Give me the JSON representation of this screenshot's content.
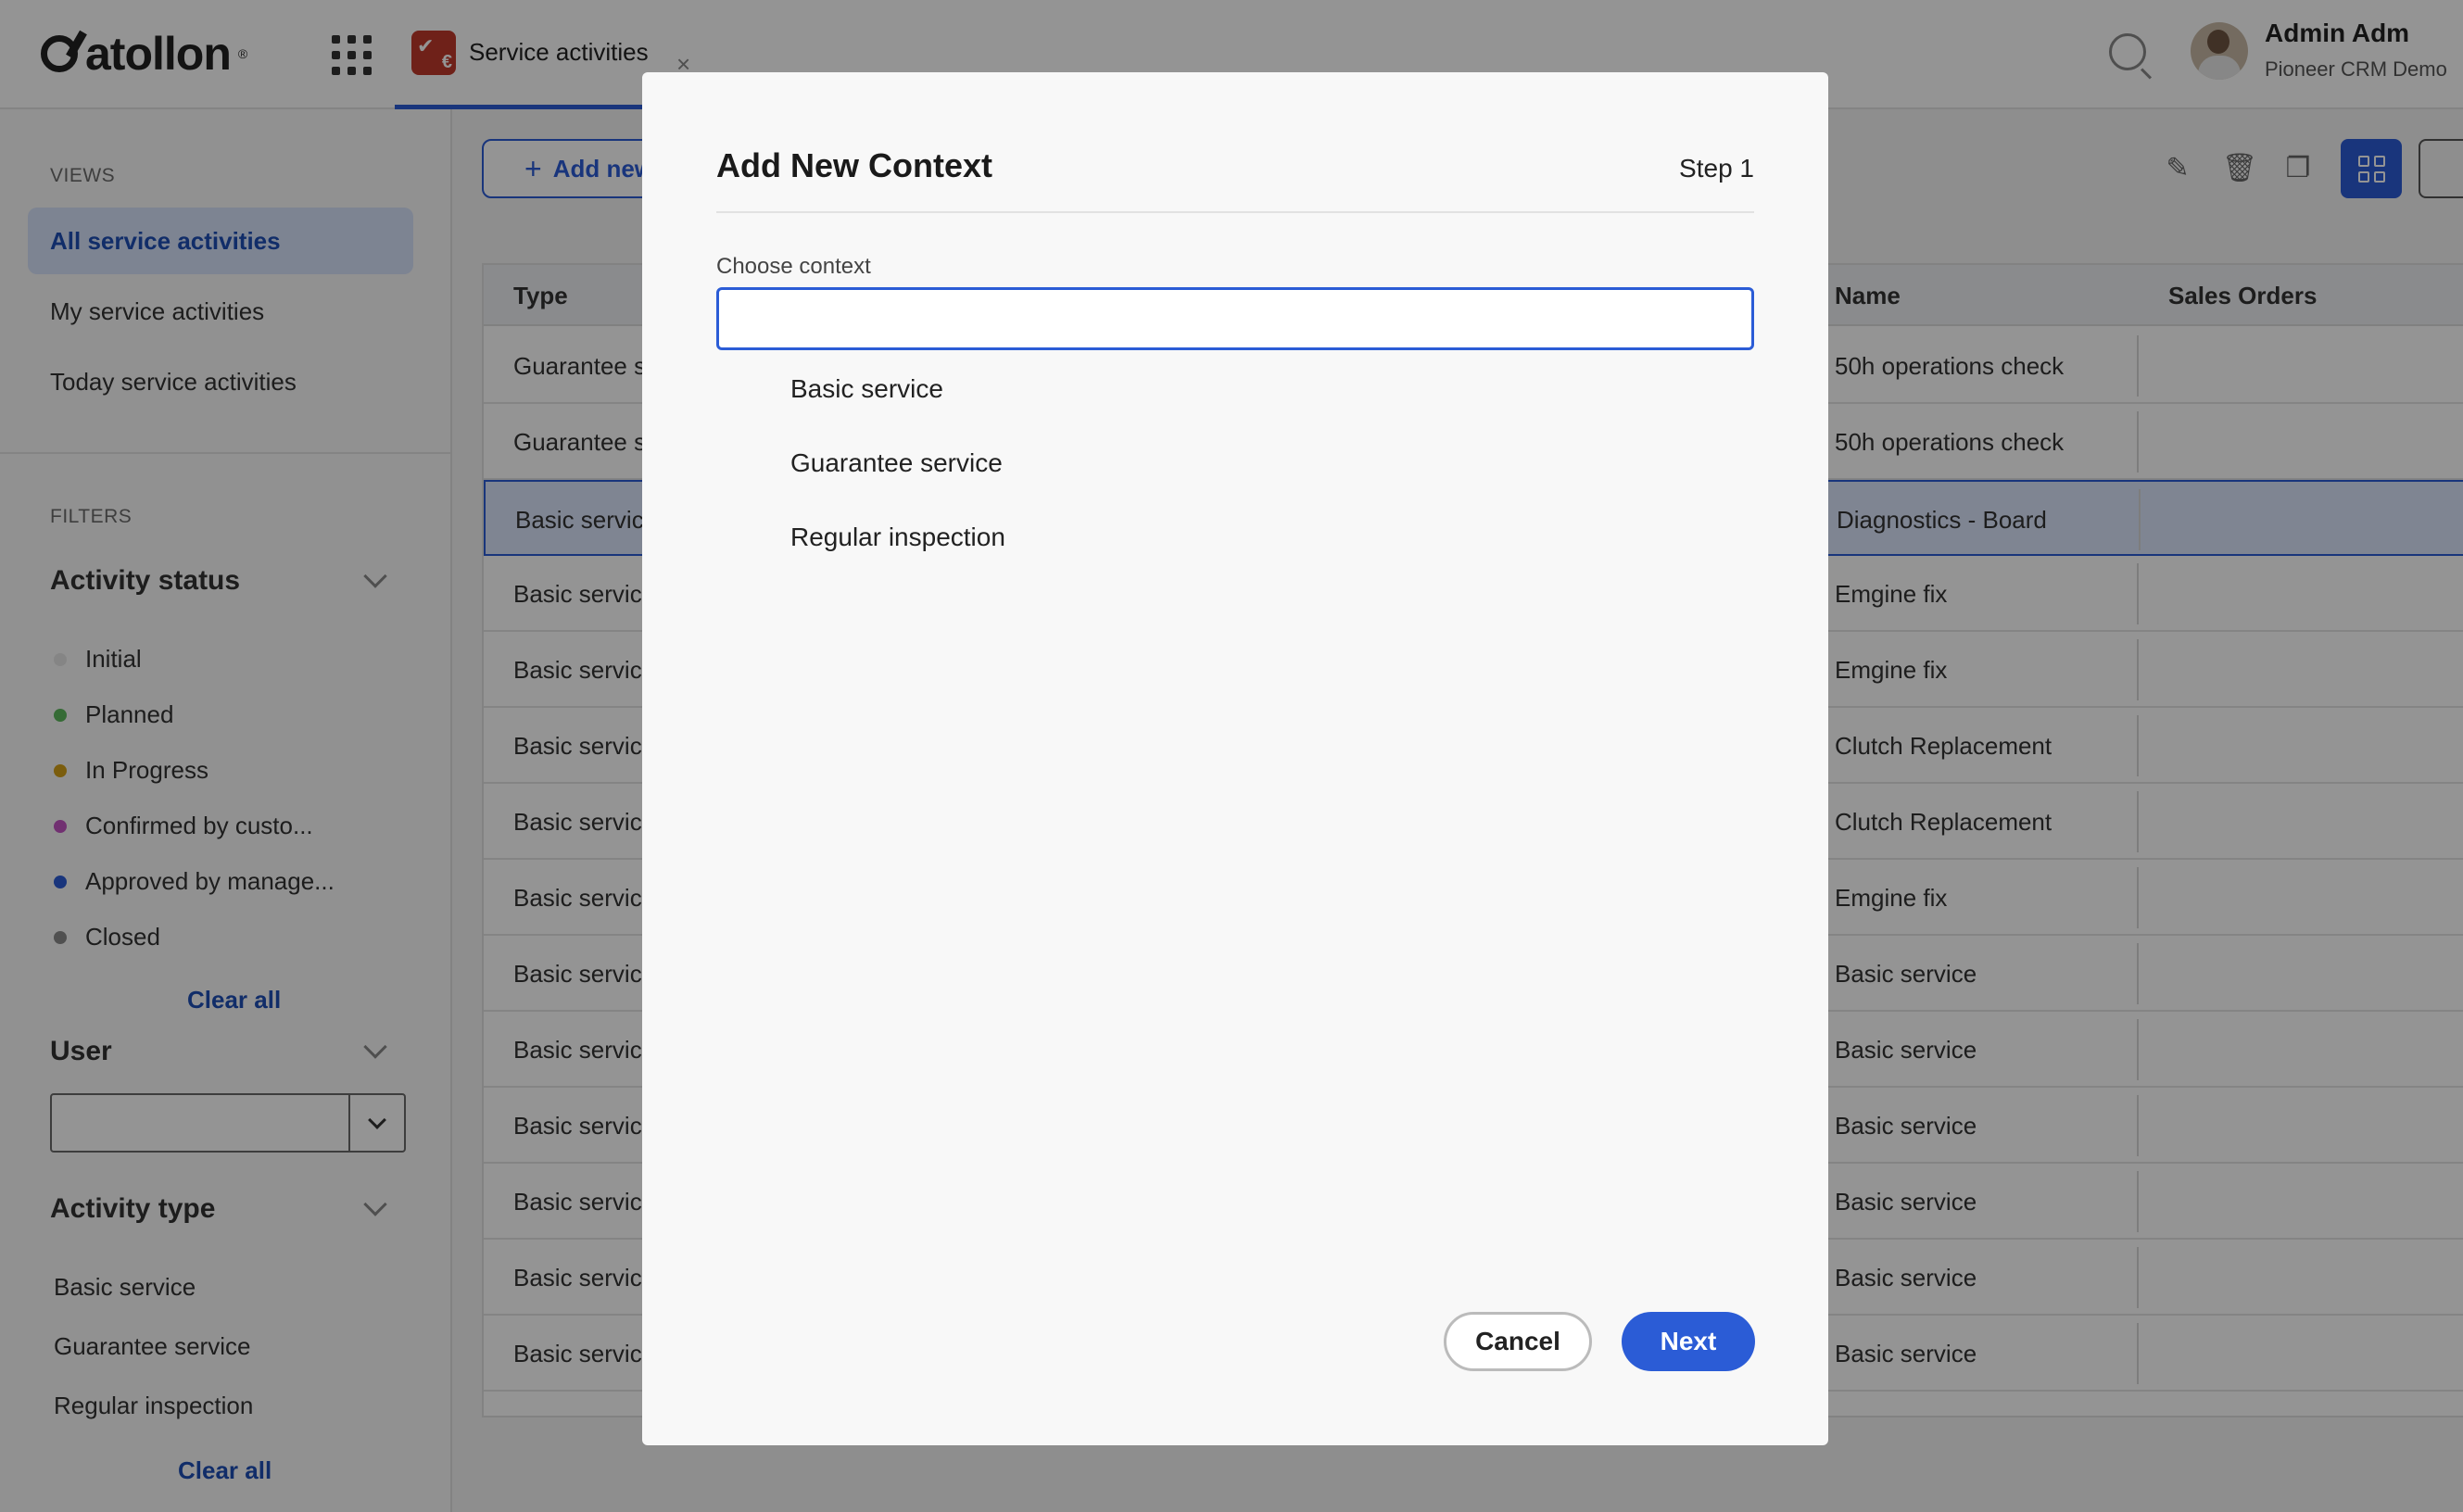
{
  "header": {
    "logo_text": "atollon",
    "app_tab_label": "Service activities",
    "close_glyph": "×",
    "user_name": "Admin Adm",
    "user_org": "Pioneer CRM Demo"
  },
  "sidebar": {
    "views_title": "VIEWS",
    "views": [
      {
        "label": "All service activities",
        "active": true
      },
      {
        "label": "My service activities",
        "active": false
      },
      {
        "label": "Today service activities",
        "active": false
      }
    ],
    "filters_title": "FILTERS",
    "activity_status": {
      "title": "Activity status",
      "items": [
        {
          "label": "Initial",
          "color": "#e6e6e6"
        },
        {
          "label": "Planned",
          "color": "#5cb85c"
        },
        {
          "label": "In Progress",
          "color": "#d4a017"
        },
        {
          "label": "Confirmed by custo...",
          "color": "#c353c3"
        },
        {
          "label": "Approved by manage...",
          "color": "#2b5cd6"
        },
        {
          "label": "Closed",
          "color": "#8a8a8a"
        }
      ],
      "clear_label": "Clear all"
    },
    "user_filter": {
      "title": "User"
    },
    "activity_type": {
      "title": "Activity type",
      "items": [
        "Basic service",
        "Guarantee service",
        "Regular inspection"
      ],
      "clear_label": "Clear all"
    }
  },
  "toolbar": {
    "add_label": "Add new",
    "icons": [
      "edit-icon",
      "trash-icon",
      "copy-icon",
      "grid-view-icon",
      "fullscreen-icon"
    ],
    "accent": "#2b5cd6"
  },
  "table": {
    "columns": {
      "type": "Type",
      "name": "Name",
      "sales_orders": "Sales Orders"
    },
    "rows": [
      {
        "type": "Guarantee se",
        "name": "50h operations check",
        "sales_orders": ""
      },
      {
        "type": "Guarantee se",
        "name": "50h operations check",
        "sales_orders": ""
      },
      {
        "type": "Basic service",
        "name": "Diagnostics - Board",
        "sales_orders": "",
        "selected": true
      },
      {
        "type": "Basic service",
        "name": "Emgine fix",
        "sales_orders": ""
      },
      {
        "type": "Basic service",
        "name": "Emgine fix",
        "sales_orders": ""
      },
      {
        "type": "Basic service",
        "name": "Clutch Replacement",
        "sales_orders": ""
      },
      {
        "type": "Basic service",
        "name": "Clutch Replacement",
        "sales_orders": ""
      },
      {
        "type": "Basic service",
        "name": "Emgine fix",
        "sales_orders": ""
      },
      {
        "type": "Basic service",
        "name": "Basic service",
        "sales_orders": ""
      },
      {
        "type": "Basic service",
        "name": "Basic service",
        "sales_orders": ""
      },
      {
        "type": "Basic service",
        "name": "Basic service",
        "sales_orders": ""
      },
      {
        "type": "Basic service",
        "name": "Basic service",
        "sales_orders": ""
      },
      {
        "type": "Basic service",
        "name": "Basic service",
        "sales_orders": ""
      },
      {
        "type": "Basic service",
        "name": "Basic service",
        "sales_orders": ""
      }
    ]
  },
  "modal": {
    "title": "Add New Context",
    "step": "Step 1",
    "field_label": "Choose context",
    "input_value": "",
    "options": [
      "Basic service",
      "Guarantee service",
      "Regular inspection"
    ],
    "cancel_label": "Cancel",
    "next_label": "Next"
  }
}
